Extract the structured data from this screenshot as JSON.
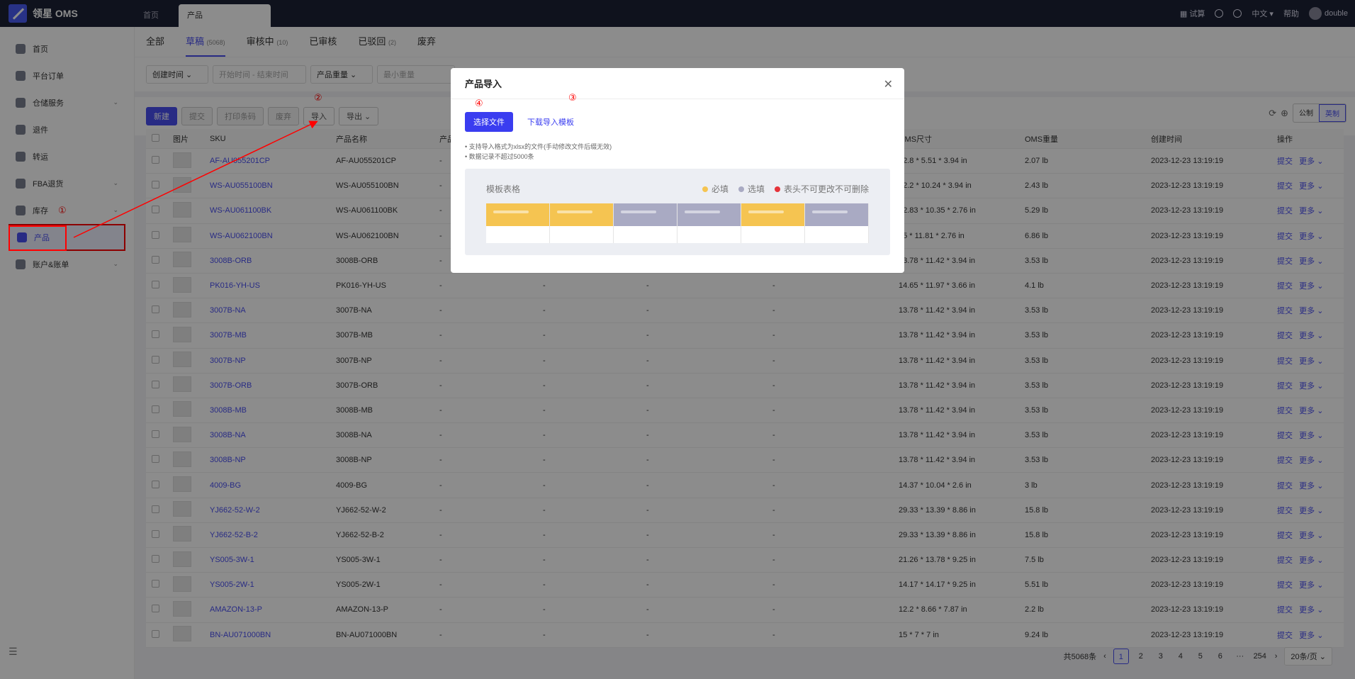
{
  "app": {
    "logo_text": "领星 OMS",
    "tabs": [
      "首页",
      "产品"
    ]
  },
  "topbar": {
    "trial": "试算",
    "language": "中文",
    "help": "帮助",
    "user": "double"
  },
  "sidebar": {
    "items": [
      {
        "label": "首页",
        "chevron": false
      },
      {
        "label": "平台订单",
        "chevron": false
      },
      {
        "label": "仓储服务",
        "chevron": true
      },
      {
        "label": "退件",
        "chevron": false
      },
      {
        "label": "转运",
        "chevron": false
      },
      {
        "label": "FBA退货",
        "chevron": true
      },
      {
        "label": "库存",
        "chevron": true
      },
      {
        "label": "产品",
        "chevron": false
      },
      {
        "label": "账户&账单",
        "chevron": true
      }
    ]
  },
  "status_tabs": [
    {
      "label": "全部",
      "count": ""
    },
    {
      "label": "草稿",
      "count": "(5068)"
    },
    {
      "label": "审核中",
      "count": "(10)"
    },
    {
      "label": "已审核",
      "count": ""
    },
    {
      "label": "已驳回",
      "count": "(2)"
    },
    {
      "label": "废弃",
      "count": ""
    }
  ],
  "filters": {
    "date_type": "创建时间",
    "date_range_placeholder": "开始时间 - 结束时间",
    "weight_type": "产品重量",
    "min_weight_placeholder": "最小重量"
  },
  "actions": {
    "new": "新建",
    "submit": "提交",
    "print_barcode": "打印条码",
    "discard": "废弃",
    "import": "导入",
    "export": "导出",
    "unit_metric": "公制",
    "unit_imperial": "英制"
  },
  "table": {
    "headers": [
      "图片",
      "SKU",
      "产品名称",
      "产品",
      "",
      "",
      "",
      "OMS尺寸",
      "OMS重量",
      "创建时间",
      "操作"
    ],
    "action_submit": "提交",
    "action_more": "更多",
    "rows": [
      {
        "sku": "AF-AU055201CP",
        "name": "AF-AU055201CP",
        "size": "12.8 * 5.51 * 3.94 in",
        "weight": "2.07 lb",
        "time": "2023-12-23 13:19:19"
      },
      {
        "sku": "WS-AU055100BN",
        "name": "WS-AU055100BN",
        "size": "12.2 * 10.24 * 3.94 in",
        "weight": "2.43 lb",
        "time": "2023-12-23 13:19:19"
      },
      {
        "sku": "WS-AU061100BK",
        "name": "WS-AU061100BK",
        "size": "12.83 * 10.35 * 2.76 in",
        "weight": "5.29 lb",
        "time": "2023-12-23 13:19:19"
      },
      {
        "sku": "WS-AU062100BN",
        "name": "WS-AU062100BN",
        "size": "15 * 11.81 * 2.76 in",
        "weight": "6.86 lb",
        "time": "2023-12-23 13:19:19"
      },
      {
        "sku": "3008B-ORB",
        "name": "3008B-ORB",
        "size": "13.78 * 11.42 * 3.94 in",
        "weight": "3.53 lb",
        "time": "2023-12-23 13:19:19"
      },
      {
        "sku": "PK016-YH-US",
        "name": "PK016-YH-US",
        "size": "14.65 * 11.97 * 3.66 in",
        "weight": "4.1 lb",
        "time": "2023-12-23 13:19:19"
      },
      {
        "sku": "3007B-NA",
        "name": "3007B-NA",
        "size": "13.78 * 11.42 * 3.94 in",
        "weight": "3.53 lb",
        "time": "2023-12-23 13:19:19"
      },
      {
        "sku": "3007B-MB",
        "name": "3007B-MB",
        "size": "13.78 * 11.42 * 3.94 in",
        "weight": "3.53 lb",
        "time": "2023-12-23 13:19:19"
      },
      {
        "sku": "3007B-NP",
        "name": "3007B-NP",
        "size": "13.78 * 11.42 * 3.94 in",
        "weight": "3.53 lb",
        "time": "2023-12-23 13:19:19"
      },
      {
        "sku": "3007B-ORB",
        "name": "3007B-ORB",
        "size": "13.78 * 11.42 * 3.94 in",
        "weight": "3.53 lb",
        "time": "2023-12-23 13:19:19"
      },
      {
        "sku": "3008B-MB",
        "name": "3008B-MB",
        "size": "13.78 * 11.42 * 3.94 in",
        "weight": "3.53 lb",
        "time": "2023-12-23 13:19:19"
      },
      {
        "sku": "3008B-NA",
        "name": "3008B-NA",
        "size": "13.78 * 11.42 * 3.94 in",
        "weight": "3.53 lb",
        "time": "2023-12-23 13:19:19"
      },
      {
        "sku": "3008B-NP",
        "name": "3008B-NP",
        "size": "13.78 * 11.42 * 3.94 in",
        "weight": "3.53 lb",
        "time": "2023-12-23 13:19:19"
      },
      {
        "sku": "4009-BG",
        "name": "4009-BG",
        "size": "14.37 * 10.04 * 2.6 in",
        "weight": "3 lb",
        "time": "2023-12-23 13:19:19"
      },
      {
        "sku": "YJ662-52-W-2",
        "name": "YJ662-52-W-2",
        "size": "29.33 * 13.39 * 8.86 in",
        "weight": "15.8 lb",
        "time": "2023-12-23 13:19:19"
      },
      {
        "sku": "YJ662-52-B-2",
        "name": "YJ662-52-B-2",
        "size": "29.33 * 13.39 * 8.86 in",
        "weight": "15.8 lb",
        "time": "2023-12-23 13:19:19"
      },
      {
        "sku": "YS005-3W-1",
        "name": "YS005-3W-1",
        "size": "21.26 * 13.78 * 9.25 in",
        "weight": "7.5 lb",
        "time": "2023-12-23 13:19:19"
      },
      {
        "sku": "YS005-2W-1",
        "name": "YS005-2W-1",
        "size": "14.17 * 14.17 * 9.25 in",
        "weight": "5.51 lb",
        "time": "2023-12-23 13:19:19"
      },
      {
        "sku": "AMAZON-13-P",
        "name": "AMAZON-13-P",
        "size": "12.2 * 8.66 * 7.87 in",
        "weight": "2.2 lb",
        "time": "2023-12-23 13:19:19"
      },
      {
        "sku": "BN-AU071000BN",
        "name": "BN-AU071000BN",
        "size": "15 * 7 * 7 in",
        "weight": "9.24 lb",
        "time": "2023-12-23 13:19:19"
      }
    ]
  },
  "pagination": {
    "total": "共5068条",
    "pages": [
      "1",
      "2",
      "3",
      "4",
      "5",
      "6",
      "···",
      "254"
    ],
    "page_size": "20条/页"
  },
  "annotations": [
    "①",
    "②",
    "③",
    "④"
  ],
  "modal": {
    "title": "产品导入",
    "select_file": "选择文件",
    "download_template": "下载导入模板",
    "notes": [
      "• 支持导入格式为xlsx的文件(手动修改文件后缀无效)",
      "• 数据记录不超过5000条"
    ],
    "template_title": "模板表格",
    "legend": [
      "必填",
      "选填",
      "表头不可更改不可删除"
    ],
    "colors": {
      "required": "#f5c451",
      "optional": "#a9aac3",
      "locked": "#e5333a"
    }
  }
}
